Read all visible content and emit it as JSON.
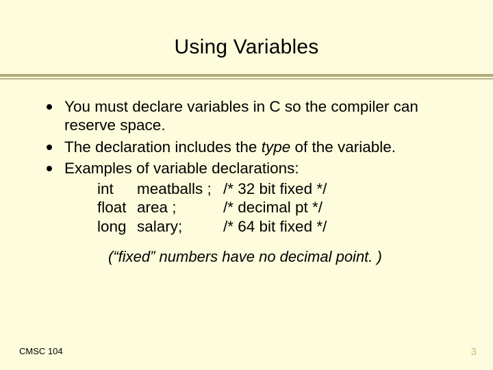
{
  "title": "Using Variables",
  "bullets": {
    "b1": "You must declare variables in C so the compiler can reserve space.",
    "b2a": "The declaration includes the ",
    "b2b": "type",
    "b2c": " of the variable.",
    "b3": "Examples of variable declarations:"
  },
  "decls": [
    {
      "type": "int",
      "name": "meatballs ;",
      "cmt": "/* 32 bit fixed */"
    },
    {
      "type": "float",
      "name": "area ;",
      "cmt": "/* decimal pt */"
    },
    {
      "type": "long",
      "name": "salary;",
      "cmt": "/* 64 bit fixed */"
    }
  ],
  "note": "(“fixed” numbers have no decimal point. )",
  "footer": {
    "left": "CMSC 104",
    "right": "3"
  }
}
